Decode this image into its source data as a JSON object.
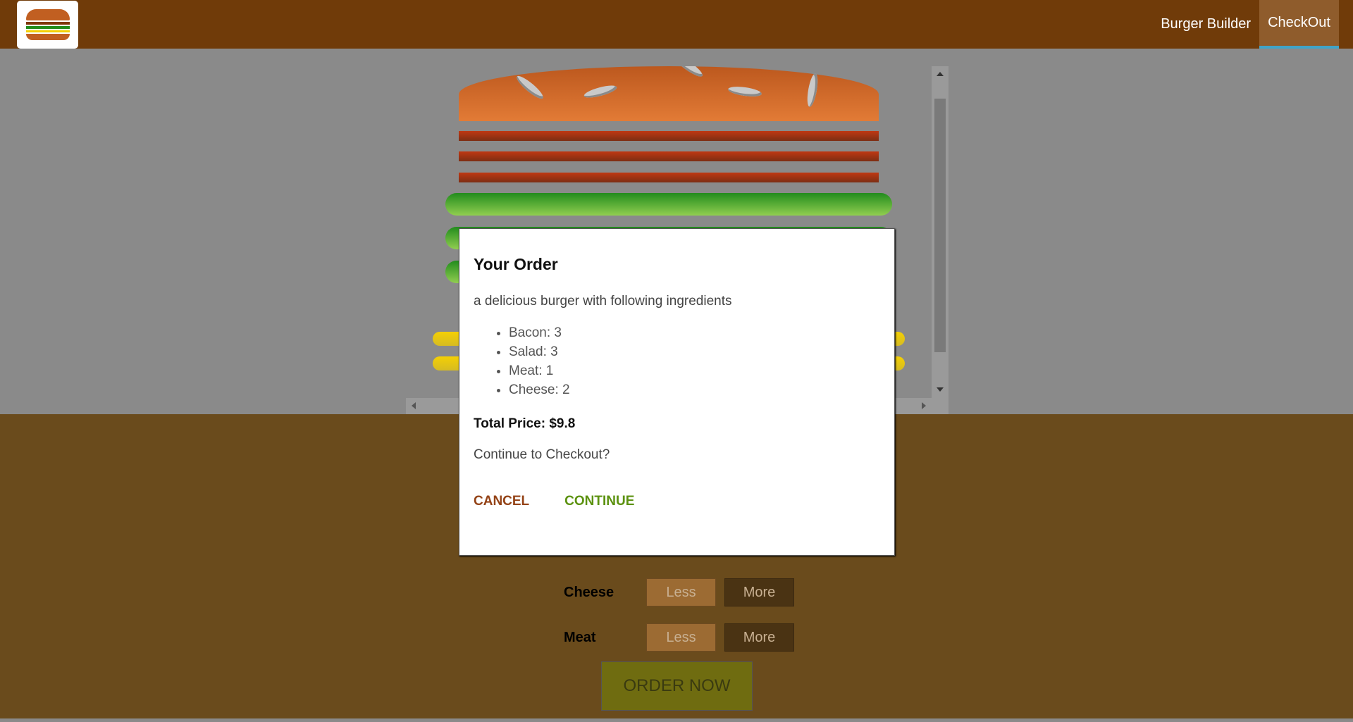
{
  "nav": {
    "items": [
      {
        "label": "Burger Builder",
        "active": false
      },
      {
        "label": "CheckOut",
        "active": true
      }
    ]
  },
  "controls": {
    "rows": [
      {
        "label": "Cheese",
        "less": "Less",
        "more": "More"
      },
      {
        "label": "Meat",
        "less": "Less",
        "more": "More"
      }
    ],
    "order_label": "ORDER NOW"
  },
  "modal": {
    "title": "Your Order",
    "description": "a delicious burger with following ingredients",
    "ingredients": [
      "Bacon: 3",
      "Salad: 3",
      "Meat: 1",
      "Cheese: 2"
    ],
    "total": "Total Price: $9.8",
    "question": "Continue to Checkout?",
    "cancel_label": "CANCEL",
    "continue_label": "CONTINUE"
  },
  "colors": {
    "toolbar": "#703b09",
    "nav_active_border": "#40a4c8",
    "cancel": "#944317",
    "continue": "#5c9210"
  }
}
